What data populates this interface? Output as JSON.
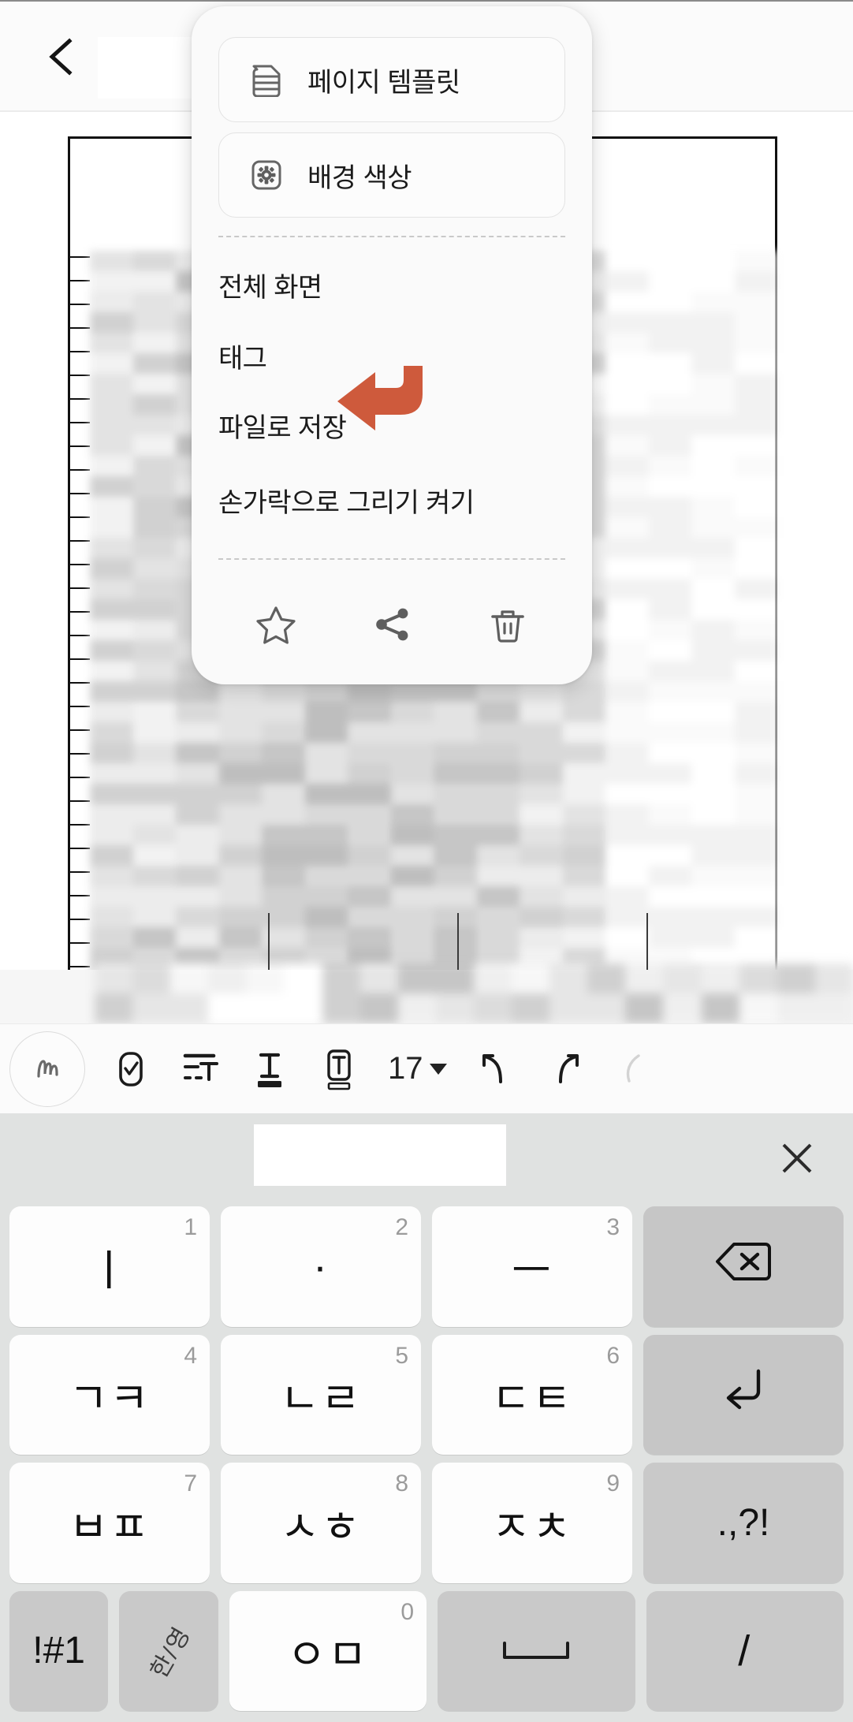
{
  "header": {
    "back_icon": "chevron-left-icon",
    "title": "",
    "more_icon": "kebab-menu-icon"
  },
  "context_menu": {
    "cards": [
      {
        "icon": "page-template-icon",
        "label": "페이지 템플릿"
      },
      {
        "icon": "background-color-gear-icon",
        "label": "배경 색상"
      }
    ],
    "items": [
      {
        "label": "전체 화면"
      },
      {
        "label": "태그"
      },
      {
        "label": "파일로 저장"
      },
      {
        "label": "손가락으로 그리기 켜기"
      }
    ],
    "actions": [
      {
        "icon": "star-icon",
        "name": "favorite"
      },
      {
        "icon": "share-icon",
        "name": "share"
      },
      {
        "icon": "trash-icon",
        "name": "delete"
      }
    ]
  },
  "annotation": {
    "arrow_color": "#CE5A3C",
    "points_to": "파일로 저장"
  },
  "toolbar": {
    "pen_icon": "handwriting-pen-icon",
    "buttons": [
      {
        "icon": "checkbox-icon",
        "name": "checklist"
      },
      {
        "icon": "text-indent-icon",
        "name": "paragraph-style"
      },
      {
        "icon": "text-format-icon",
        "name": "text-color"
      },
      {
        "icon": "text-box-icon",
        "name": "text-highlight"
      }
    ],
    "font_size": "17",
    "font_size_caret": "chevron-down-icon",
    "undo_icon": "undo-icon",
    "redo_icon": "redo-icon",
    "eraser_icon": "eraser-icon"
  },
  "keyboard": {
    "close_icon": "close-icon",
    "suggestion": "",
    "rows": [
      [
        {
          "label": "ㅣ",
          "num": "1",
          "type": "char"
        },
        {
          "label": "·",
          "num": "2",
          "type": "char"
        },
        {
          "label": "ㅡ",
          "num": "3",
          "type": "char"
        },
        {
          "label": "",
          "num": "",
          "type": "backspace",
          "icon": "backspace-icon"
        }
      ],
      [
        {
          "label": "ㄱㅋ",
          "num": "4",
          "type": "char"
        },
        {
          "label": "ㄴㄹ",
          "num": "5",
          "type": "char"
        },
        {
          "label": "ㄷㅌ",
          "num": "6",
          "type": "char"
        },
        {
          "label": "",
          "num": "",
          "type": "enter",
          "icon": "enter-icon"
        }
      ],
      [
        {
          "label": "ㅂㅍ",
          "num": "7",
          "type": "char"
        },
        {
          "label": "ㅅㅎ",
          "num": "8",
          "type": "char"
        },
        {
          "label": "ㅈㅊ",
          "num": "9",
          "type": "char"
        },
        {
          "label": ".,?!",
          "num": "",
          "type": "punct"
        }
      ],
      [
        {
          "label": "!#1",
          "num": "",
          "type": "symbols"
        },
        {
          "label": "한/영",
          "num": "",
          "type": "lang"
        },
        {
          "label": "ㅇㅁ",
          "num": "0",
          "type": "char"
        },
        {
          "label": "",
          "num": "",
          "type": "space",
          "icon": "space-icon"
        },
        {
          "label": "/",
          "num": "",
          "type": "slash"
        }
      ]
    ]
  },
  "colors": {
    "menu_bg": "#fafafa",
    "keyboard_bg": "#e0e2e1",
    "key_bg": "#fdfdfd",
    "key_fn_bg": "#c6c6c6",
    "accent_red": "#CE5A3C",
    "text": "#1b1b1b"
  }
}
